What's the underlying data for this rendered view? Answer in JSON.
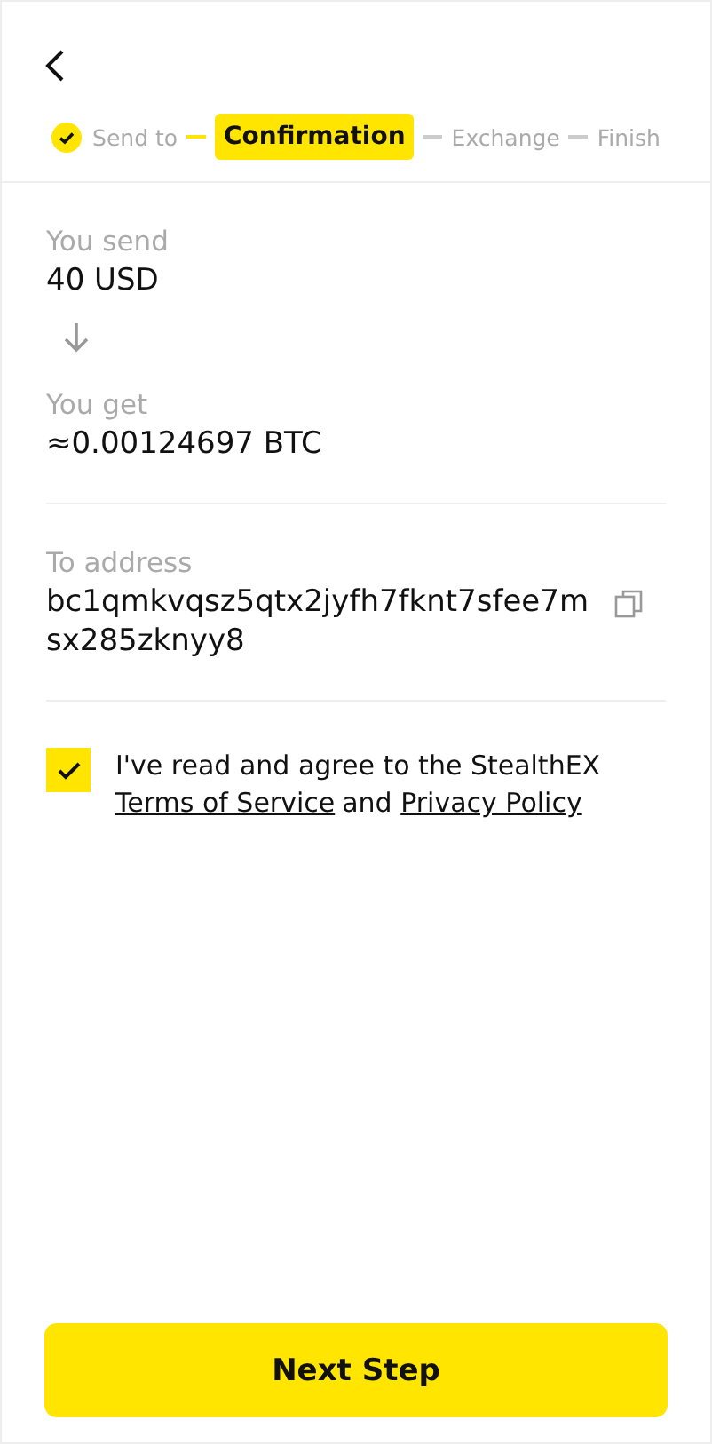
{
  "steps": [
    {
      "label": "Send to",
      "done": true,
      "selected": false
    },
    {
      "label": "Confirmation",
      "done": false,
      "selected": true
    },
    {
      "label": "Exchange",
      "done": false,
      "selected": false
    },
    {
      "label": "Finish",
      "done": false,
      "selected": false
    }
  ],
  "send": {
    "label": "You send",
    "value": "40 USD"
  },
  "get": {
    "label": "You get",
    "value": "≈0.00124697 BTC"
  },
  "address": {
    "label": "To address",
    "value": "bc1qmkvqsz5qtx2jyfh7fknt7sfee7msx285zknyy8"
  },
  "agreement": {
    "checked": true,
    "text": "I've read and agree to the StealthEX",
    "terms_link": "Terms of Service",
    "joiner": "and",
    "privacy_link": "Privacy Policy"
  },
  "primary_button": "Next Step"
}
